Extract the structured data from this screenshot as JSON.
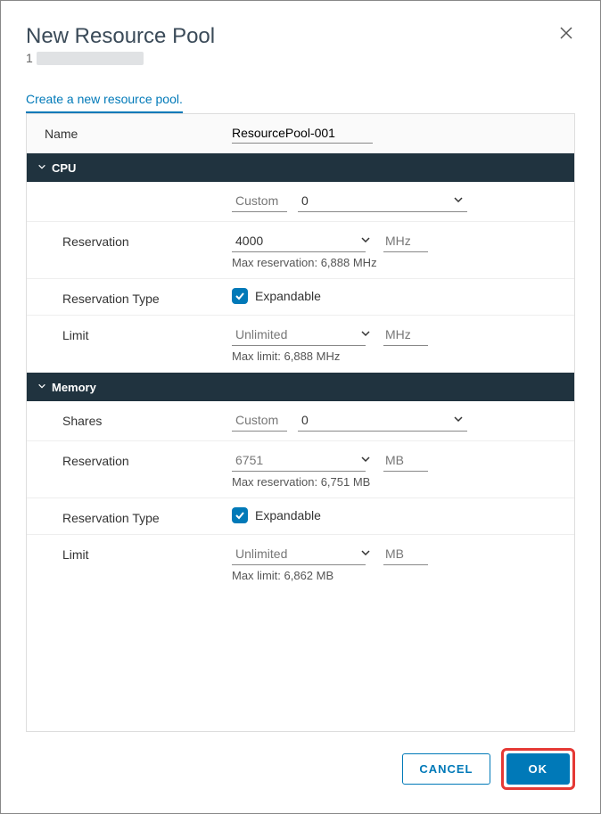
{
  "dialog": {
    "title": "New Resource Pool",
    "subtitle_prefix": "1",
    "tab_label": "Create a new resource pool."
  },
  "form": {
    "name_label": "Name",
    "name_value": "ResourcePool-001"
  },
  "cpu": {
    "section_title": "CPU",
    "shares": {
      "preset": "Custom",
      "value": "0"
    },
    "reservation": {
      "label": "Reservation",
      "value": "4000",
      "unit": "MHz",
      "hint": "Max reservation: 6,888 MHz"
    },
    "reservation_type": {
      "label": "Reservation Type",
      "checkbox_label": "Expandable",
      "checked": true
    },
    "limit": {
      "label": "Limit",
      "value": "Unlimited",
      "unit": "MHz",
      "hint": "Max limit: 6,888 MHz"
    }
  },
  "memory": {
    "section_title": "Memory",
    "shares": {
      "label": "Shares",
      "preset": "Custom",
      "value": "0"
    },
    "reservation": {
      "label": "Reservation",
      "value": "6751",
      "unit": "MB",
      "hint": "Max reservation: 6,751 MB"
    },
    "reservation_type": {
      "label": "Reservation Type",
      "checkbox_label": "Expandable",
      "checked": true
    },
    "limit": {
      "label": "Limit",
      "value": "Unlimited",
      "unit": "MB",
      "hint": "Max limit: 6,862 MB"
    }
  },
  "buttons": {
    "cancel": "CANCEL",
    "ok": "OK"
  }
}
